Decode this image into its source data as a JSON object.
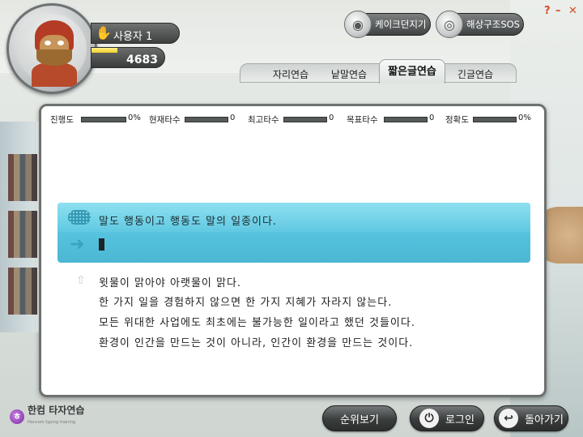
{
  "user": {
    "name": "사용자 1",
    "score": "4683",
    "level_progress": 0.35
  },
  "top_buttons": {
    "cake_dungeon": "케이크던지기",
    "sea_rescue": "해상구조SOS"
  },
  "window": {
    "help": "?",
    "minimize": "–",
    "close": "✕"
  },
  "tabs": [
    {
      "label": "자리연습",
      "active": false
    },
    {
      "label": "낱말연습",
      "active": false
    },
    {
      "label": "짧은글연습",
      "active": true
    },
    {
      "label": "긴글연습",
      "active": false
    }
  ],
  "stats": {
    "progress_label": "진행도",
    "progress_value": "0%",
    "current_speed_label": "현재타수",
    "current_speed_value": "0",
    "max_speed_label": "최고타수",
    "max_speed_value": "0",
    "goal_speed_label": "목표타수",
    "goal_speed_value": "0",
    "accuracy_label": "정확도",
    "accuracy_value": "0%"
  },
  "practice": {
    "target_sentence": "말도 행동이고 행동도 말의 일종이다.",
    "typed_text": ""
  },
  "upcoming": [
    "윗물이 맑아야 아랫물이 맑다.",
    "한 가지 일을 경험하지 않으면 한 가지 지혜가 자라지 않는다.",
    "모든 위대한 사업에도 최초에는 불가능한 일이라고 했던 것들이다.",
    "환경이 인간을 만드는 것이 아니라, 인간이 환경을 만드는 것이다."
  ],
  "brand": {
    "logo_char": "ㅎ",
    "name": "한컴 타자연습",
    "sub": "Hancom typing training"
  },
  "bottom_buttons": {
    "ranking": "순위보기",
    "login": "로그인",
    "back": "돌아가기"
  }
}
